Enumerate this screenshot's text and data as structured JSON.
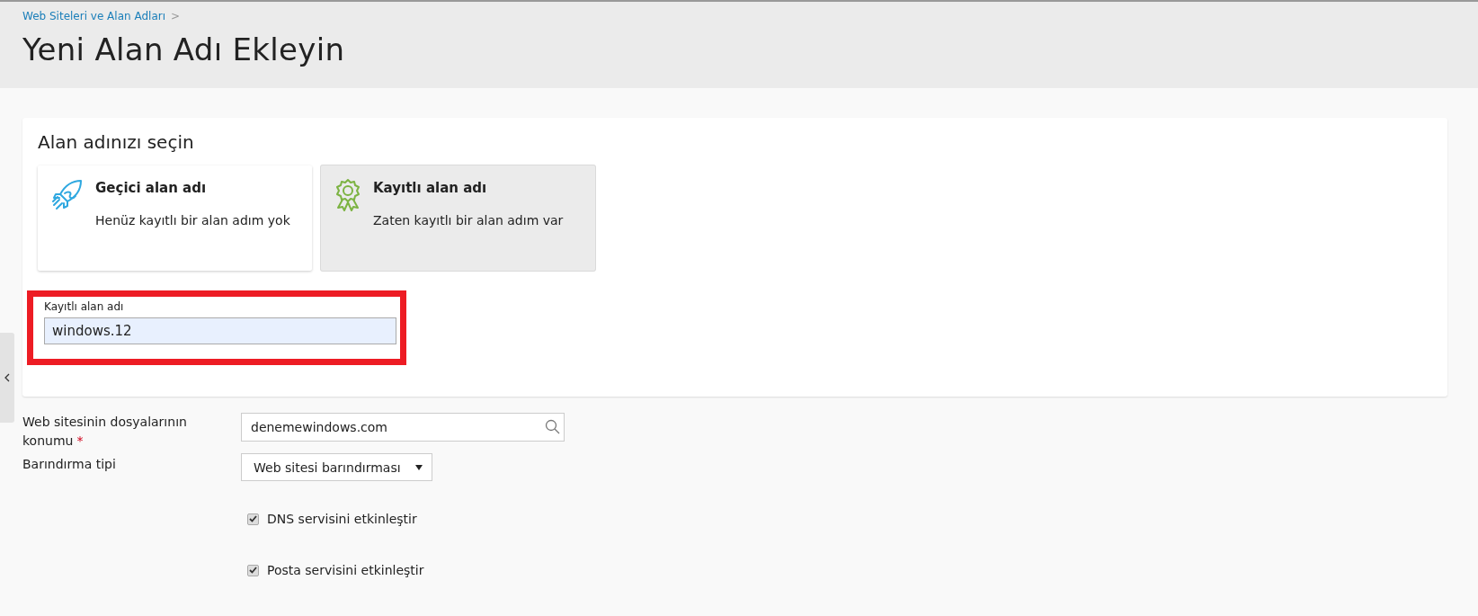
{
  "breadcrumb": {
    "label": "Web Siteleri ve Alan Adları",
    "separator": ">"
  },
  "title": "Yeni Alan Adı Ekleyin",
  "section": {
    "heading": "Alan adınızı seçin",
    "options": [
      {
        "kind": "rocket",
        "title": "Geçici alan adı",
        "description": "Henüz kayıtlı bir alan adım yok",
        "selected": false
      },
      {
        "kind": "award",
        "title": "Kayıtlı alan adı",
        "description": "Zaten kayıtlı bir alan adım var",
        "selected": true
      }
    ],
    "domain_field": {
      "label": "Kayıtlı alan adı",
      "value": "windows.12",
      "highlighted": true
    }
  },
  "form": {
    "location": {
      "label": "Web sitesinin dosyalarının konumu",
      "required": true,
      "required_mark": "*",
      "value": "denemewindows.com"
    },
    "hosting": {
      "label": "Barındırma tipi",
      "value": "Web sitesi barındırması"
    },
    "checkboxes": [
      {
        "label": "DNS servisini etkinleştir",
        "checked": true
      },
      {
        "label": "Posta servisini etkinleştir",
        "checked": true
      }
    ]
  }
}
